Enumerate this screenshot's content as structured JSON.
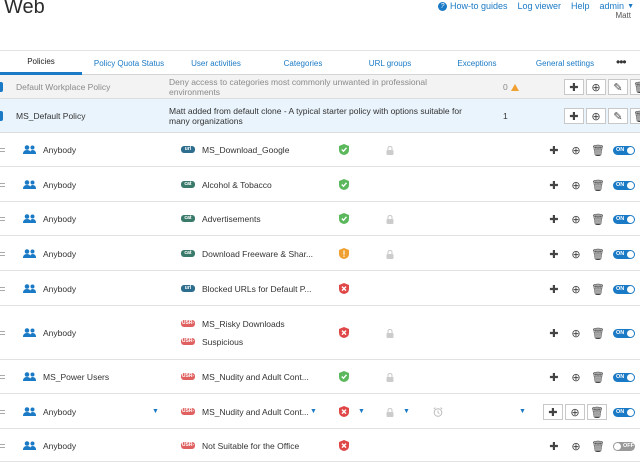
{
  "header": {
    "title": "Web",
    "links": {
      "howto": "How-to guides",
      "logviewer": "Log viewer",
      "help": "Help",
      "admin": "admin"
    },
    "username": "Matt"
  },
  "tabs": [
    "Policies",
    "Policy Quota Status",
    "User activities",
    "Categories",
    "URL groups",
    "Exceptions",
    "General settings"
  ],
  "policies": [
    {
      "name": "Default Workplace Policy",
      "description": "Deny access to categories most commonly unwanted in professional environments",
      "count": "0"
    },
    {
      "name": "MS_Default Policy",
      "description": "Matt added from default clone - A typical starter policy with options suitable for many organizations",
      "count": "1"
    }
  ],
  "rules": [
    {
      "user": "Anybody",
      "items": [
        {
          "type": "url",
          "label": "MS_Download_Google"
        }
      ],
      "action": "allow",
      "lock": true,
      "toggle": "ON"
    },
    {
      "user": "Anybody",
      "items": [
        {
          "type": "cat",
          "label": "Alcohol & Tobacco"
        }
      ],
      "action": "allow",
      "lock": false,
      "toggle": "ON"
    },
    {
      "user": "Anybody",
      "items": [
        {
          "type": "cat",
          "label": "Advertisements"
        }
      ],
      "action": "allow",
      "lock": true,
      "toggle": "ON"
    },
    {
      "user": "Anybody",
      "items": [
        {
          "type": "cat",
          "label": "Download Freeware & Shar..."
        }
      ],
      "action": "warn",
      "lock": true,
      "toggle": "ON"
    },
    {
      "user": "Anybody",
      "items": [
        {
          "type": "url",
          "label": "Blocked URLs for Default P..."
        }
      ],
      "action": "block",
      "lock": false,
      "toggle": "ON"
    },
    {
      "user": "Anybody",
      "items": [
        {
          "type": "usr",
          "label": "MS_Risky Downloads"
        },
        {
          "type": "usr",
          "label": "Suspicious"
        }
      ],
      "action": "block",
      "lock": true,
      "toggle": "ON"
    },
    {
      "user": "MS_Power Users",
      "items": [
        {
          "type": "usr",
          "label": "MS_Nudity and Adult Cont..."
        }
      ],
      "action": "allow",
      "lock": true,
      "toggle": "ON"
    },
    {
      "user": "Anybody",
      "items": [
        {
          "type": "usr",
          "label": "MS_Nudity and Adult Cont..."
        }
      ],
      "action": "block",
      "lock": true,
      "toggle": "ON"
    },
    {
      "user": "Anybody",
      "items": [
        {
          "type": "usr",
          "label": "Not Suitable for the Office"
        }
      ],
      "action": "block",
      "lock": false,
      "toggle": "OFF"
    }
  ],
  "badge_text": {
    "url": "url",
    "cat": "cat",
    "usr": "USR-A"
  },
  "colors": {
    "accent": "#1a7ac5",
    "allow": "#5cb85c",
    "warn": "#f0a030",
    "block": "#e04848"
  }
}
